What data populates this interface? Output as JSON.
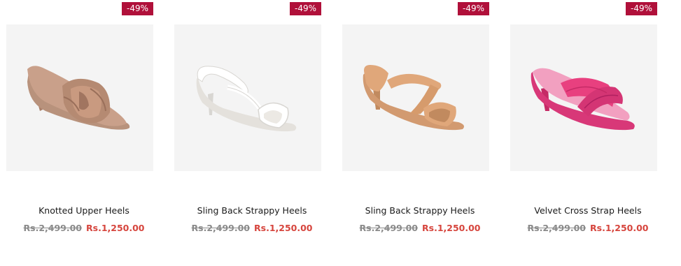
{
  "products": [
    {
      "title": "Knotted Upper Heels",
      "discount_badge": "-49%",
      "old_price": "Rs.2,499.00",
      "new_price": "Rs.1,250.00",
      "image_icon": "knotted-heel-sandal",
      "colors": {
        "main": "#c9a08a",
        "dark": "#a97f69",
        "sole": "#b8927c"
      }
    },
    {
      "title": "Sling Back Strappy Heels",
      "discount_badge": "-49%",
      "old_price": "Rs.2,499.00",
      "new_price": "Rs.1,250.00",
      "image_icon": "white-slingback-sandal",
      "colors": {
        "main": "#ffffff",
        "dark": "#d8d6d2",
        "sole": "#ece9e4"
      }
    },
    {
      "title": "Sling Back Strappy Heels",
      "discount_badge": "-49%",
      "old_price": "Rs.2,499.00",
      "new_price": "Rs.1,250.00",
      "image_icon": "nude-strappy-sandal",
      "colors": {
        "main": "#e0a77a",
        "dark": "#c18a5f",
        "sole": "#d29a70"
      }
    },
    {
      "title": "Velvet Cross Strap Heels",
      "discount_badge": "-49%",
      "old_price": "Rs.2,499.00",
      "new_price": "Rs.1,250.00",
      "image_icon": "pink-cross-strap-sandal",
      "colors": {
        "main": "#e8407f",
        "dark": "#c52a66",
        "sole": "#f2a0c0"
      }
    }
  ],
  "accent": {
    "badge": "#b0103a",
    "sale_price": "#d6453d",
    "old_price": "#8a8a8a"
  }
}
